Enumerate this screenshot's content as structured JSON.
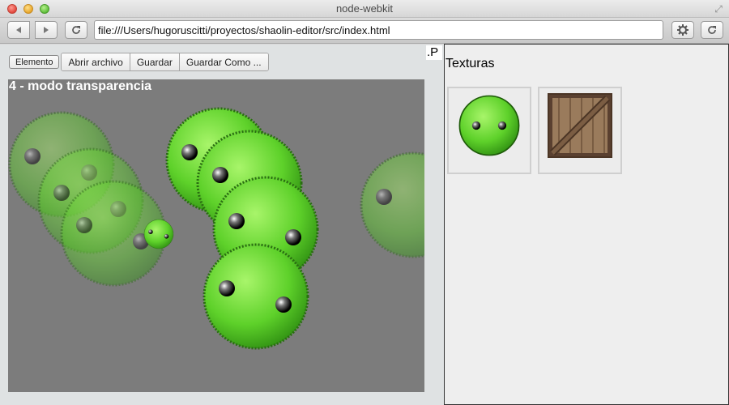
{
  "window": {
    "title": "node-webkit"
  },
  "toolbar": {
    "url": "file:///Users/hugoruscitti/proyectos/shaolin-editor/src/index.html"
  },
  "editor": {
    "buttons": {
      "elemento": "Elemento",
      "abrir": "Abrir archivo",
      "guardar": "Guardar",
      "guardar_como": "Guardar Como ..."
    },
    "canvas_title": "4 - modo transparencia",
    "marker": ".P"
  },
  "textures": {
    "title": "Texturas",
    "items": [
      "green-ball-texture",
      "wooden-crate-texture"
    ]
  },
  "colors": {
    "canvas_bg": "#7c7c7c",
    "ball": "#5ed12a",
    "panel_bg": "#eeeeee"
  }
}
